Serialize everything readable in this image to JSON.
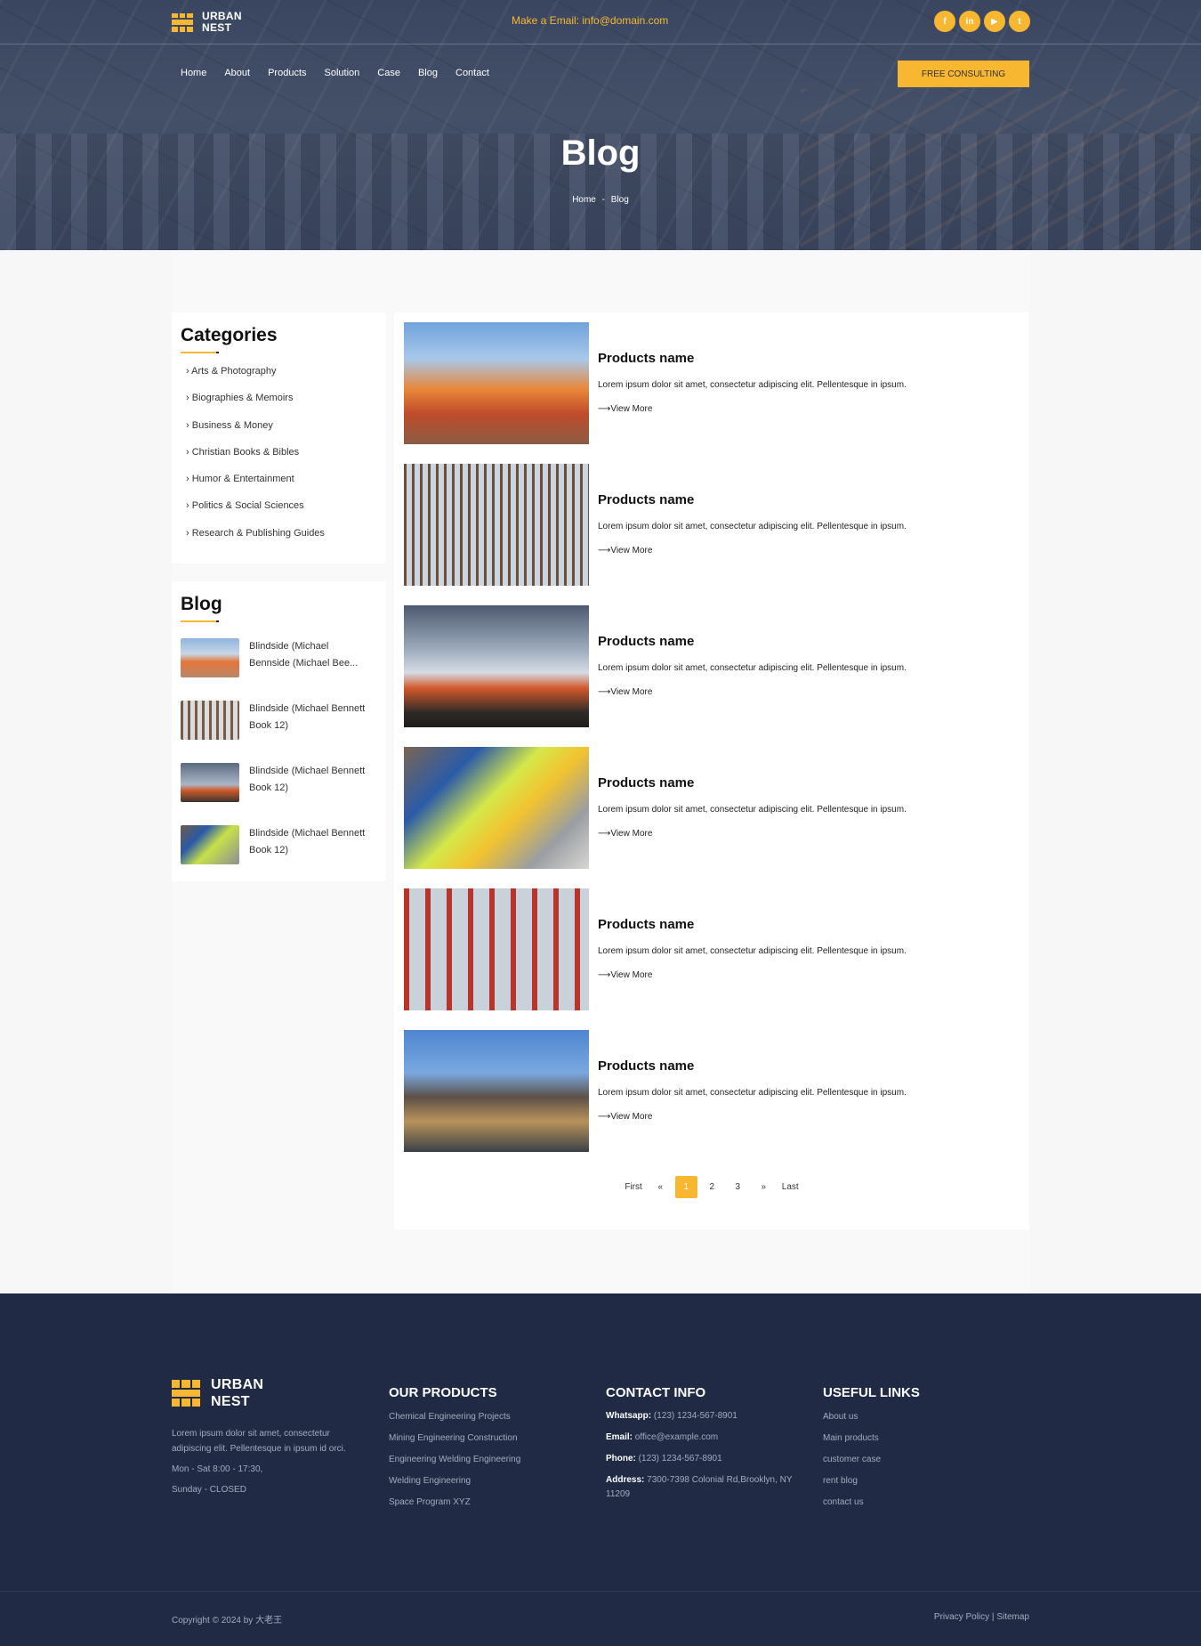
{
  "header": {
    "logo_line1": "URBAN",
    "logo_line2": "NEST",
    "email_text": "Make a Email: info@domain.com",
    "socials": [
      "f",
      "in",
      "▶",
      "t"
    ],
    "nav": [
      "Home",
      "About",
      "Products",
      "Solution",
      "Case",
      "Blog",
      "Contact"
    ],
    "cta": "FREE CONSULTING"
  },
  "hero": {
    "title": "Blog",
    "breadcrumb_home": "Home",
    "breadcrumb_sep": "-",
    "breadcrumb_current": "Blog"
  },
  "sidebar": {
    "categories_title": "Categories",
    "categories": [
      "Arts & Photography",
      "Biographies & Memoirs",
      "Business & Money",
      "Christian Books & Bibles",
      "Humor & Entertainment",
      "Politics & Social Sciences",
      "Research & Publishing Guides"
    ],
    "blog_title": "Blog",
    "blog_items": [
      "Blindside (Michael Bennside (Michael Bee...",
      "Blindside (Michael Bennett Book 12)",
      "Blindside (Michael Bennett Book 12)",
      "Blindside (Michael Bennett Book 12)"
    ]
  },
  "posts": [
    {
      "title": "Products name",
      "desc": "Lorem ipsum dolor sit amet, consectetur adipiscing elit. Pellentesque in ipsum.",
      "more": "⟶View More"
    },
    {
      "title": "Products name",
      "desc": "Lorem ipsum dolor sit amet, consectetur adipiscing elit. Pellentesque in ipsum.",
      "more": "⟶View More"
    },
    {
      "title": "Products name",
      "desc": "Lorem ipsum dolor sit amet, consectetur adipiscing elit. Pellentesque in ipsum.",
      "more": "⟶View More"
    },
    {
      "title": "Products name",
      "desc": "Lorem ipsum dolor sit amet, consectetur adipiscing elit. Pellentesque in ipsum.",
      "more": "⟶View More"
    },
    {
      "title": "Products name",
      "desc": "Lorem ipsum dolor sit amet, consectetur adipiscing elit. Pellentesque in ipsum.",
      "more": "⟶View More"
    },
    {
      "title": "Products name",
      "desc": "Lorem ipsum dolor sit amet, consectetur adipiscing elit. Pellentesque in ipsum.",
      "more": "⟶View More"
    }
  ],
  "pagination": {
    "first": "First",
    "prev": "«",
    "pages": [
      "1",
      "2",
      "3"
    ],
    "current": "1",
    "next": "»",
    "last": "Last"
  },
  "footer": {
    "logo_line1": "URBAN",
    "logo_line2": "NEST",
    "about": "Lorem ipsum dolor sit amet, consectetur adipiscing elit. Pellentesque in ipsum id orci.",
    "hours1": "Mon - Sat 8:00 - 17:30,",
    "hours2": "Sunday - CLOSED",
    "products_title": "OUR PRODUCTS",
    "products": [
      "Chemical Engineering Projects",
      "Mining Engineering Construction",
      "Engineering Welding Engineering",
      "Welding Engineering",
      "Space Program XYZ"
    ],
    "contact_title": "CONTACT INFO",
    "contact": [
      {
        "label": "Whatsapp:",
        "value": "(123) 1234-567-8901"
      },
      {
        "label": "Email:",
        "value": "office@example.com"
      },
      {
        "label": "Phone:",
        "value": "(123) 1234-567-8901"
      },
      {
        "label": "Address:",
        "value": "7300-7398 Colonial Rd,Brooklyn, NY 11209"
      }
    ],
    "links_title": "USEFUL LINKS",
    "links": [
      "About us",
      "Main products",
      "customer case",
      "rent blog",
      "contact us"
    ],
    "copyright": "Copyright © 2024 by 大老王",
    "privacy": "Privacy Policy | Sitemap"
  },
  "colors": {
    "accent": "#f7b731",
    "footer_bg": "#202a44",
    "hero_overlay": "#3f4b64"
  }
}
